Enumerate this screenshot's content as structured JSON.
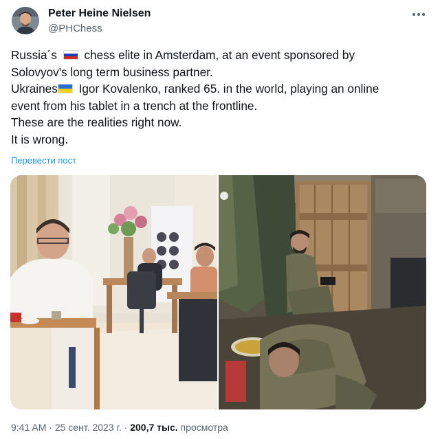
{
  "author": {
    "name": "Peter Heine Nielsen",
    "handle": "@PHChess"
  },
  "tweet": {
    "line1a": "Russia´s ",
    "line1b": " chess elite in Amsterdam, at an event sponsored by",
    "line2": "Solovyov's long term business partner.",
    "line3a": "Ukraines",
    "line3b": " Igor Kovalenko, ranked 65. in the world, playing an online",
    "line4": "event from his tablet in a trench at the frontline.",
    "line5": "These are the realities right now.",
    "line6": "It is wrong.",
    "flags": [
      "russia-flag",
      "ukraine-flag"
    ]
  },
  "translate_label": "Перевести пост",
  "meta": {
    "time": "9:41 AM",
    "sep1": " · ",
    "date": "25 сент. 2023 г.",
    "sep2": " · ",
    "views_count": "200,7 тыс.",
    "views_label": " просмотра"
  },
  "colors": {
    "link": "#1d9bf0",
    "secondary_text": "#536471",
    "primary_text": "#0f1419"
  },
  "icons": [
    "more-options-icon"
  ]
}
